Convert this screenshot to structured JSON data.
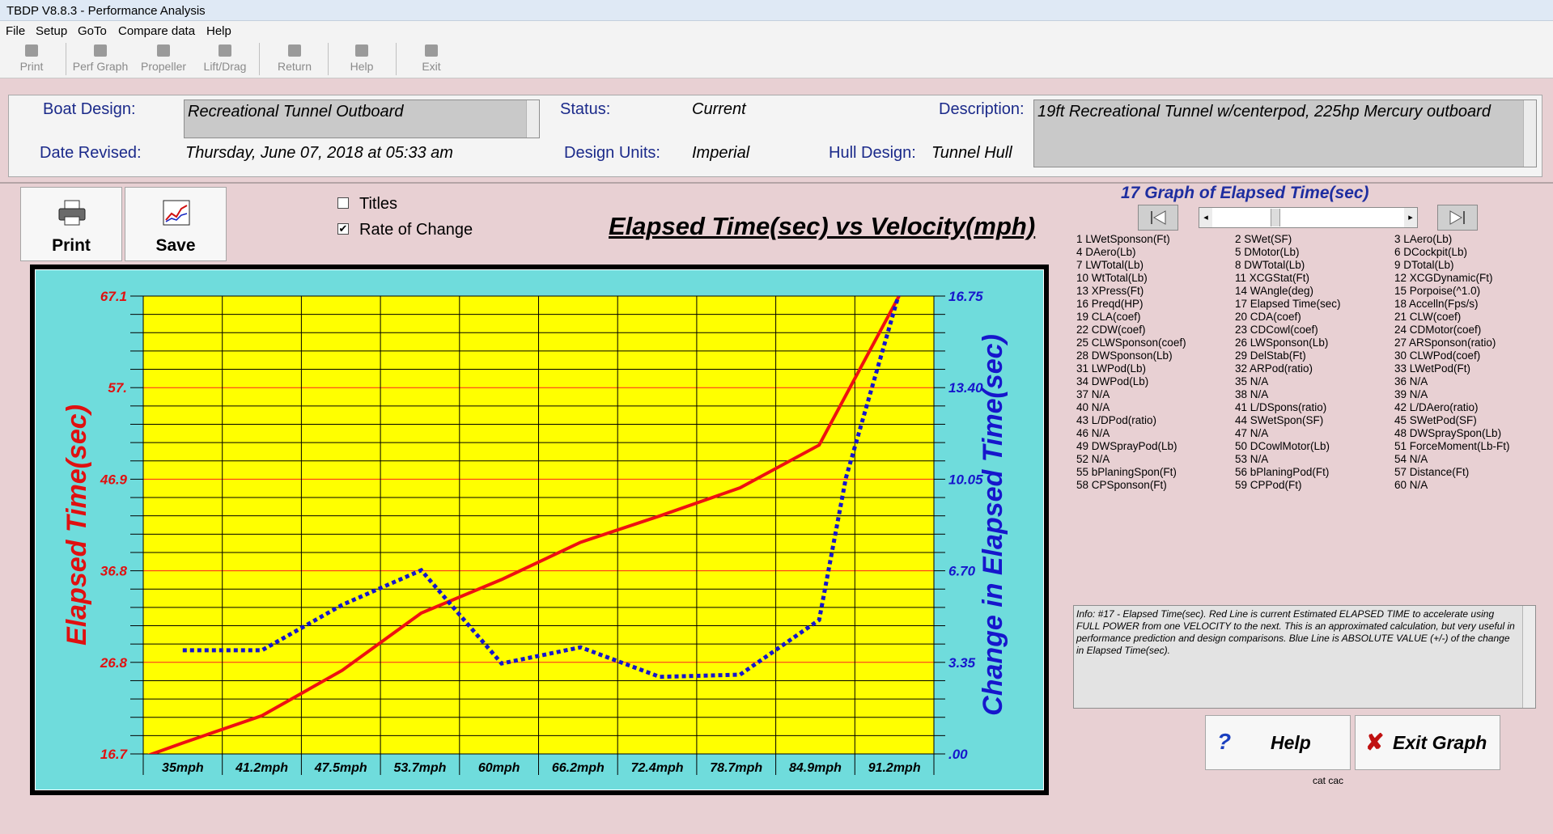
{
  "window": {
    "title": "TBDP V8.8.3 - Performance Analysis"
  },
  "menu": [
    "File",
    "Setup",
    "GoTo",
    "Compare data",
    "Help"
  ],
  "toolbar": [
    {
      "label": "Print",
      "icon": "printer-icon"
    },
    {
      "label": "Perf Graph",
      "icon": "graph-icon"
    },
    {
      "label": "Propeller",
      "icon": "propeller-icon"
    },
    {
      "label": "Lift/Drag",
      "icon": "lift-drag-icon"
    },
    {
      "label": "Return",
      "icon": "return-arrow-icon"
    },
    {
      "label": "Help",
      "icon": "question-icon"
    },
    {
      "label": "Exit",
      "icon": "exit-icon"
    }
  ],
  "info": {
    "boat_design_label": "Boat Design:",
    "boat_design": "Recreational Tunnel Outboard",
    "status_label": "Status:",
    "status": "Current",
    "description_label": "Description:",
    "description": "19ft Recreational Tunnel w/centerpod, 225hp Mercury outboard",
    "date_revised_label": "Date Revised:",
    "date_revised": "Thursday, June 07, 2018 at 05:33 am",
    "design_units_label": "Design Units:",
    "design_units": "Imperial",
    "hull_design_label": "Hull Design:",
    "hull_design": "Tunnel Hull"
  },
  "buttons": {
    "print": "Print",
    "save": "Save",
    "help": "Help",
    "exit_graph": "Exit Graph"
  },
  "options": {
    "titles_label": "Titles",
    "titles_checked": false,
    "rate_label": "Rate of Change",
    "rate_checked": true
  },
  "graph_heading": "17 Graph of Elapsed Time(sec)",
  "parameters": [
    [
      "1 LWetSponson(Ft)",
      "2 SWet(SF)",
      "3 LAero(Lb)"
    ],
    [
      "4 DAero(Lb)",
      "5 DMotor(Lb)",
      "6 DCockpit(Lb)"
    ],
    [
      "7 LWTotal(Lb)",
      "8 DWTotal(Lb)",
      "9 DTotal(Lb)"
    ],
    [
      "10 WtTotal(Lb)",
      "11 XCGStat(Ft)",
      "12 XCGDynamic(Ft)"
    ],
    [
      "13 XPress(Ft)",
      "14 WAngle(deg)",
      "15 Porpoise(^1.0)"
    ],
    [
      "16 Preqd(HP)",
      "17 Elapsed Time(sec)",
      "18 Accelln(Fps/s)"
    ],
    [
      "19 CLA(coef)",
      "20 CDA(coef)",
      "21 CLW(coef)"
    ],
    [
      "22 CDW(coef)",
      "23 CDCowl(coef)",
      "24 CDMotor(coef)"
    ],
    [
      "25 CLWSponson(coef)",
      "26 LWSponson(Lb)",
      "27 ARSponson(ratio)"
    ],
    [
      "28 DWSponson(Lb)",
      "29 DelStab(Ft)",
      "30 CLWPod(coef)"
    ],
    [
      "31 LWPod(Lb)",
      "32 ARPod(ratio)",
      "33 LWetPod(Ft)"
    ],
    [
      "34 DWPod(Lb)",
      "35 N/A",
      "36 N/A"
    ],
    [
      "37 N/A",
      "38 N/A",
      "39 N/A"
    ],
    [
      "40 N/A",
      "41 L/DSpons(ratio)",
      "42 L/DAero(ratio)"
    ],
    [
      "43 L/DPod(ratio)",
      "44 SWetSpon(SF)",
      "45 SWetPod(SF)"
    ],
    [
      "46 N/A",
      "47 N/A",
      "48 DWSpraySpon(Lb)"
    ],
    [
      "49 DWSprayPod(Lb)",
      "50 DCowlMotor(Lb)",
      "51 ForceMoment(Lb-Ft)"
    ],
    [
      "52 N/A",
      "53 N/A",
      "54 N/A"
    ],
    [
      "55 bPlaningSpon(Ft)",
      "56 bPlaningPod(Ft)",
      "57 Distance(Ft)"
    ],
    [
      "58 CPSponson(Ft)",
      "59 CPPod(Ft)",
      "60 N/A"
    ]
  ],
  "info_text": "Info: #17 - Elapsed Time(sec). Red Line is current Estimated ELAPSED TIME to accelerate using FULL POWER from one VELOCITY to the next.  This is an approximated calculation, but very useful in performance prediction and design comparisons.  Blue Line is ABSOLUTE VALUE (+/-) of the change in Elapsed Time(sec).",
  "footer_text": "cat cac",
  "colors": {
    "plot_bg": "#ffff00",
    "chart_bg": "#6fdcdc",
    "primary_line": "#ee1111",
    "secondary_line": "#1616cc"
  },
  "chart_data": {
    "type": "line",
    "title": "Elapsed Time(sec) vs Velocity(mph)",
    "ylabel": "Elapsed Time(sec)",
    "y2label": "Change in Elapsed Time(sec)",
    "categories": [
      "35mph",
      "41.2mph",
      "47.5mph",
      "53.7mph",
      "60mph",
      "66.2mph",
      "72.4mph",
      "78.7mph",
      "84.9mph",
      "91.2mph"
    ],
    "y_ticks": [
      "16.7",
      "26.8",
      "36.8",
      "46.9",
      "57.",
      "67.1"
    ],
    "y2_ticks": [
      ".00",
      "3.35",
      "6.70",
      "10.05",
      "13.40",
      "16.75"
    ],
    "ylim": [
      16.7,
      67.1
    ],
    "y2lim": [
      0,
      16.75
    ],
    "grid": true,
    "series": [
      {
        "axis": "left",
        "style": "solid",
        "x": [
          32.0,
          35,
          41.2,
          47.5,
          53.7,
          60,
          66.2,
          72.4,
          78.7,
          84.9,
          91.2
        ],
        "values": [
          16.4,
          17.9,
          20.9,
          25.9,
          32.2,
          35.9,
          40.0,
          42.9,
          46.0,
          50.7,
          67.2
        ]
      },
      {
        "axis": "right",
        "style": "dotted",
        "x": [
          35,
          41.2,
          47.5,
          53.7,
          60,
          66.2,
          72.4,
          78.7,
          84.9,
          87.0,
          91.2
        ],
        "values": [
          3.79,
          3.79,
          5.45,
          6.72,
          3.31,
          3.9,
          2.82,
          2.9,
          4.9,
          10.1,
          16.9
        ]
      }
    ]
  }
}
